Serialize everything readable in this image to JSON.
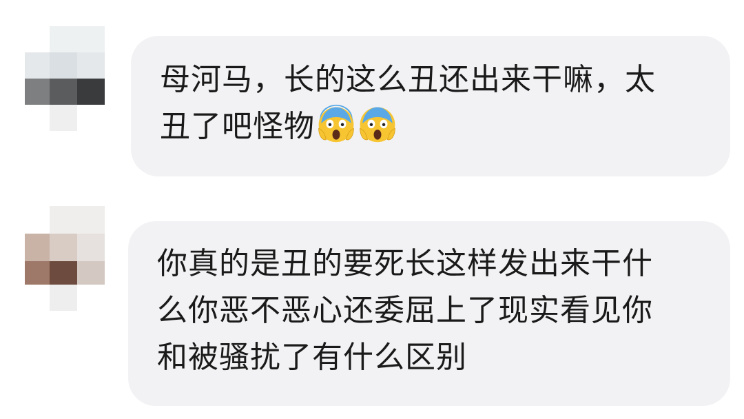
{
  "messages": [
    {
      "avatar": "blurred-avatar-icon",
      "lines": [
        "母河马，长的这么丑还出来干嘛，太",
        "丑了吧怪物"
      ],
      "emojis": [
        "face-screaming-in-fear-icon",
        "face-screaming-in-fear-icon"
      ]
    },
    {
      "avatar": "blurred-avatar-icon",
      "lines": [
        "你真的是丑的要死长这样发出来干什",
        "么你恶不恶心还委屈上了现实看见你",
        "和被骚扰了有什么区别"
      ]
    }
  ],
  "colors": {
    "bubble": "#f2f2f4",
    "text": "#1a1a1a",
    "emoji_yellow": "#f7c531",
    "emoji_blue": "#5aa9e6"
  }
}
